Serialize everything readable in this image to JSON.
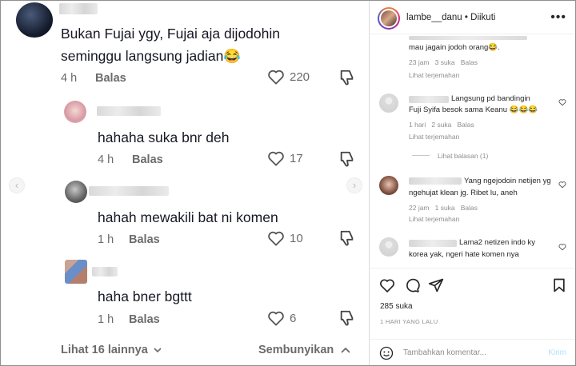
{
  "tiktok": {
    "comments": [
      {
        "text": "Bukan Fujai ygy, Fujai aja dijodohin",
        "text2": "seminggu langsung jadian😂",
        "time": "4 h",
        "reply": "Balas",
        "likes": "220"
      },
      {
        "text": "hahaha suka bnr deh",
        "time": "4 h",
        "reply": "Balas",
        "likes": "17"
      },
      {
        "text": "hahah mewakili bat ni komen",
        "time": "1 h",
        "reply": "Balas",
        "likes": "10"
      },
      {
        "text": "haha bner bgttt",
        "time": "1 h",
        "reply": "Balas",
        "likes": "6"
      }
    ],
    "view_more": "Lihat 16 lainnya",
    "hide": "Sembunyikan"
  },
  "instagram": {
    "username": "lambe__danu",
    "following": "Diikuti",
    "comments": [
      {
        "text": "mau jagain jodoh orang😂.",
        "time": "23 jam",
        "likes": "3 suka",
        "reply": "Balas",
        "translate": "Lihat terjemahan"
      },
      {
        "text": "Langsung pd bandingin",
        "text2": "Fuji Syifa besok sama Keanu 😂😂😂",
        "time": "1 hari",
        "likes": "2 suka",
        "reply": "Balas",
        "translate": "Lihat terjemahan",
        "replies": "Lihat balasan (1)"
      },
      {
        "text": "Yang ngejodoin netijen yg",
        "text2": "ngehujat klean jg. Ribet lu, aneh",
        "time": "22 jam",
        "likes": "1 suka",
        "reply": "Balas",
        "translate": "Lihat terjemahan"
      },
      {
        "text": "Lama2 netizen indo ky",
        "text2": "korea yak, ngeri hate komen nya"
      }
    ],
    "like_count": "285 suka",
    "post_time": "1 HARI YANG LALU",
    "add_comment_placeholder": "Tambahkan komentar...",
    "post_label": "Kirim"
  },
  "icons": {
    "heart": "heart-icon",
    "dislike": "thumbs-down-icon",
    "more": "more-icon"
  },
  "colors": {
    "link_light": "#b2dffc",
    "muted": "#8e8e8e"
  }
}
